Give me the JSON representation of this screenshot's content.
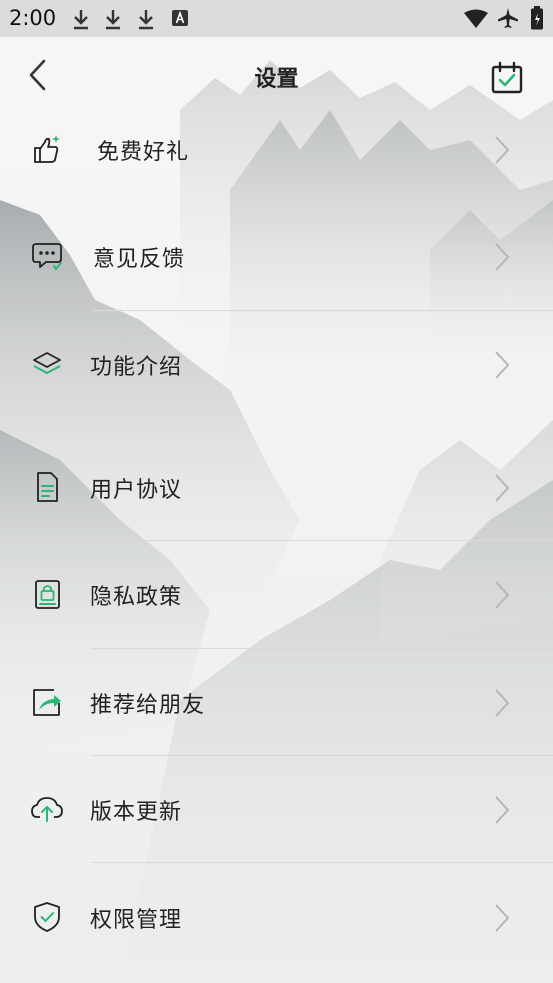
{
  "status_bar": {
    "time": "2:00",
    "left_icons": [
      "download-icon",
      "download-icon",
      "download-icon",
      "keyboard-a-icon"
    ],
    "right_icons": [
      "wifi-icon",
      "airplane-icon",
      "battery-icon"
    ]
  },
  "header": {
    "title": "设置",
    "back_icon": "chevron-left-icon",
    "action_icon": "calendar-check-icon"
  },
  "accent_color": "#2bb673",
  "menu": [
    {
      "label": "免费好礼",
      "icon": "thumbs-up-icon"
    },
    {
      "label": "意见反馈",
      "icon": "chat-bubble-icon"
    },
    {
      "label": "功能介绍",
      "icon": "layers-icon"
    },
    {
      "label": "用户协议",
      "icon": "document-icon"
    },
    {
      "label": "隐私政策",
      "icon": "lock-icon"
    },
    {
      "label": "推荐给朋友",
      "icon": "share-icon"
    },
    {
      "label": "版本更新",
      "icon": "cloud-upload-icon"
    },
    {
      "label": "权限管理",
      "icon": "shield-check-icon"
    }
  ]
}
